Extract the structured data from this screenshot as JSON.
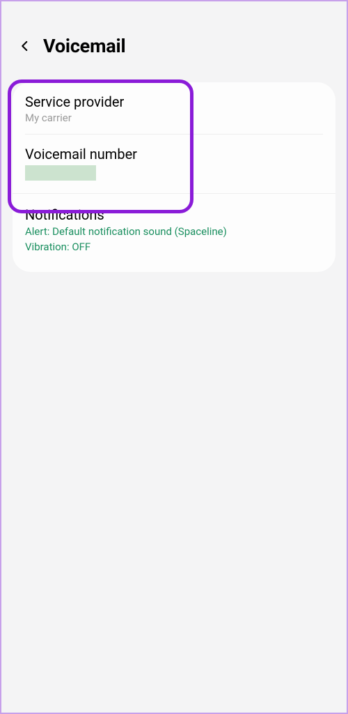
{
  "header": {
    "title": "Voicemail"
  },
  "settings": {
    "service_provider": {
      "label": "Service provider",
      "value": "My carrier"
    },
    "voicemail_number": {
      "label": "Voicemail number"
    },
    "notifications": {
      "label": "Notifications",
      "alert_line": "Alert: Default notification sound (Spaceline)",
      "vibration_line": "Vibration: OFF"
    }
  }
}
